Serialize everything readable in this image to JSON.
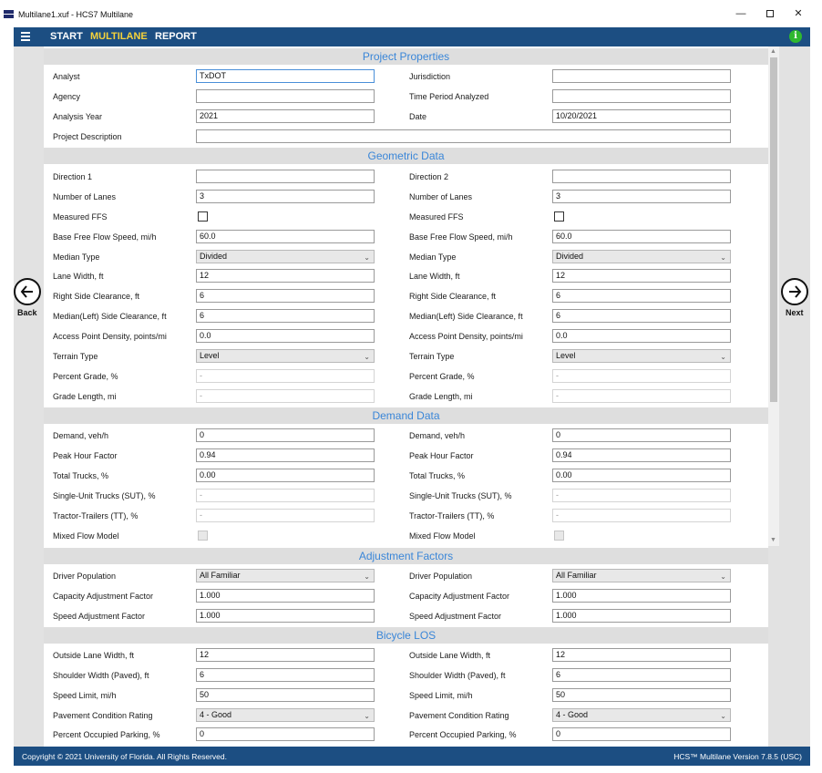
{
  "window": {
    "title": "Multilane1.xuf - HCS7 Multilane",
    "minimize": "—",
    "close": "✕"
  },
  "menu": {
    "start": "START",
    "multilane": "MULTILANE",
    "report": "REPORT",
    "info": "i"
  },
  "nav": {
    "back_label": "Back",
    "next_label": "Next"
  },
  "sections": {
    "project": "Project Properties",
    "geometric": "Geometric Data",
    "demand": "Demand Data",
    "adjustment": "Adjustment Factors",
    "bicycle": "Bicycle LOS"
  },
  "project": {
    "analyst_label": "Analyst",
    "analyst_value": "TxDOT",
    "jurisdiction_label": "Jurisdiction",
    "jurisdiction_value": "",
    "agency_label": "Agency",
    "agency_value": "",
    "time_period_label": "Time Period Analyzed",
    "time_period_value": "",
    "analysis_year_label": "Analysis Year",
    "analysis_year_value": "2021",
    "date_label": "Date",
    "date_value": "10/20/2021",
    "description_label": "Project Description",
    "description_value": ""
  },
  "geometric": {
    "dir1": {
      "direction_label": "Direction 1",
      "direction_value": "",
      "lanes_label": "Number of Lanes",
      "lanes_value": "3",
      "measured_ffs_label": "Measured FFS",
      "bffs_label": "Base Free Flow Speed, mi/h",
      "bffs_value": "60.0",
      "median_label": "Median Type",
      "median_value": "Divided",
      "lane_width_label": "Lane Width, ft",
      "lane_width_value": "12",
      "right_clear_label": "Right Side Clearance, ft",
      "right_clear_value": "6",
      "median_clear_label": "Median(Left) Side Clearance, ft",
      "median_clear_value": "6",
      "access_label": "Access Point Density, points/mi",
      "access_value": "0.0",
      "terrain_label": "Terrain Type",
      "terrain_value": "Level",
      "grade_label": "Percent Grade, %",
      "grade_value": "-",
      "grade_len_label": "Grade Length, mi",
      "grade_len_value": "-"
    },
    "dir2": {
      "direction_label": "Direction 2",
      "direction_value": "",
      "lanes_label": "Number of Lanes",
      "lanes_value": "3",
      "measured_ffs_label": "Measured FFS",
      "bffs_label": "Base Free Flow Speed, mi/h",
      "bffs_value": "60.0",
      "median_label": "Median Type",
      "median_value": "Divided",
      "lane_width_label": "Lane Width, ft",
      "lane_width_value": "12",
      "right_clear_label": "Right Side Clearance, ft",
      "right_clear_value": "6",
      "median_clear_label": "Median(Left) Side Clearance, ft",
      "median_clear_value": "6",
      "access_label": "Access Point Density, points/mi",
      "access_value": "0.0",
      "terrain_label": "Terrain Type",
      "terrain_value": "Level",
      "grade_label": "Percent Grade, %",
      "grade_value": "-",
      "grade_len_label": "Grade Length, mi",
      "grade_len_value": "-"
    }
  },
  "demand": {
    "dir1": {
      "demand_label": "Demand, veh/h",
      "demand_value": "0",
      "phf_label": "Peak Hour Factor",
      "phf_value": "0.94",
      "trucks_label": "Total Trucks, %",
      "trucks_value": "0.00",
      "sut_label": "Single-Unit Trucks (SUT), %",
      "sut_value": "-",
      "tt_label": "Tractor-Trailers (TT), %",
      "tt_value": "-",
      "mixed_label": "Mixed Flow Model"
    },
    "dir2": {
      "demand_label": "Demand, veh/h",
      "demand_value": "0",
      "phf_label": "Peak Hour Factor",
      "phf_value": "0.94",
      "trucks_label": "Total Trucks, %",
      "trucks_value": "0.00",
      "sut_label": "Single-Unit Trucks (SUT), %",
      "sut_value": "-",
      "tt_label": "Tractor-Trailers (TT), %",
      "tt_value": "-",
      "mixed_label": "Mixed Flow Model"
    }
  },
  "adjustment": {
    "dir1": {
      "driver_label": "Driver Population",
      "driver_value": "All Familiar",
      "caf_label": "Capacity Adjustment Factor",
      "caf_value": "1.000",
      "saf_label": "Speed Adjustment Factor",
      "saf_value": "1.000"
    },
    "dir2": {
      "driver_label": "Driver Population",
      "driver_value": "All Familiar",
      "caf_label": "Capacity Adjustment Factor",
      "caf_value": "1.000",
      "saf_label": "Speed Adjustment Factor",
      "saf_value": "1.000"
    }
  },
  "bicycle": {
    "dir1": {
      "olw_label": "Outside Lane Width, ft",
      "olw_value": "12",
      "shoulder_label": "Shoulder Width (Paved), ft",
      "shoulder_value": "6",
      "speed_label": "Speed Limit, mi/h",
      "speed_value": "50",
      "pavement_label": "Pavement Condition Rating",
      "pavement_value": "4 - Good",
      "parking_label": "Percent Occupied Parking, %",
      "parking_value": "0"
    },
    "dir2": {
      "olw_label": "Outside Lane Width, ft",
      "olw_value": "12",
      "shoulder_label": "Shoulder Width (Paved), ft",
      "shoulder_value": "6",
      "speed_label": "Speed Limit, mi/h",
      "speed_value": "50",
      "pavement_label": "Pavement Condition Rating",
      "pavement_value": "4 - Good",
      "parking_label": "Percent Occupied Parking, %",
      "parking_value": "0"
    }
  },
  "footer": {
    "copyright": "Copyright © 2021 University of Florida. All Rights Reserved.",
    "version": "HCS™ Multilane Version 7.8.5 (USC)"
  },
  "colors": {
    "menubar": "#1c4e82",
    "active_menu": "#f7d33a",
    "section_text": "#3a86d8",
    "info": "#2fb82f"
  }
}
